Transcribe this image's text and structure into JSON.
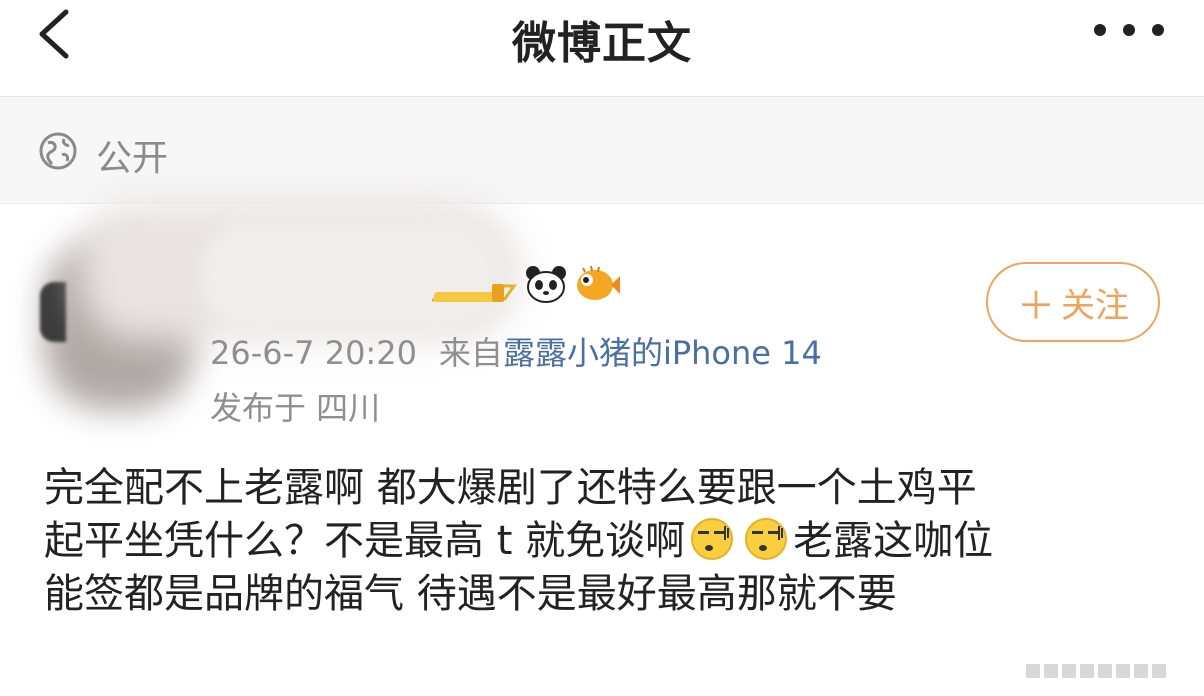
{
  "nav": {
    "title": "微博正文"
  },
  "visibility": {
    "label": "公开",
    "icon": "globe-icon"
  },
  "user": {
    "badges": [
      "vip-badge",
      "panda-emoji",
      "fish-emoji"
    ],
    "follow_label": "关注",
    "follow_icon": "plus-icon"
  },
  "meta": {
    "timestamp": "26-6-7 20:20",
    "source_prefix": "来自",
    "device": "露露小猪的iPhone 14",
    "location": "发布于 四川"
  },
  "post": {
    "line1": "完全配不上老露啊 都大爆剧了还特么要跟一个土鸡平",
    "line2_a": "起平坐凭什么？不是最高 t 就免谈啊",
    "line2_b": "老露这咖位",
    "line3": "能签都是品牌的福气 待遇不是最好最高那就不要"
  },
  "colors": {
    "accent": "#f2a35b",
    "link": "#4a6fa5",
    "muted": "#8f8f8f"
  }
}
